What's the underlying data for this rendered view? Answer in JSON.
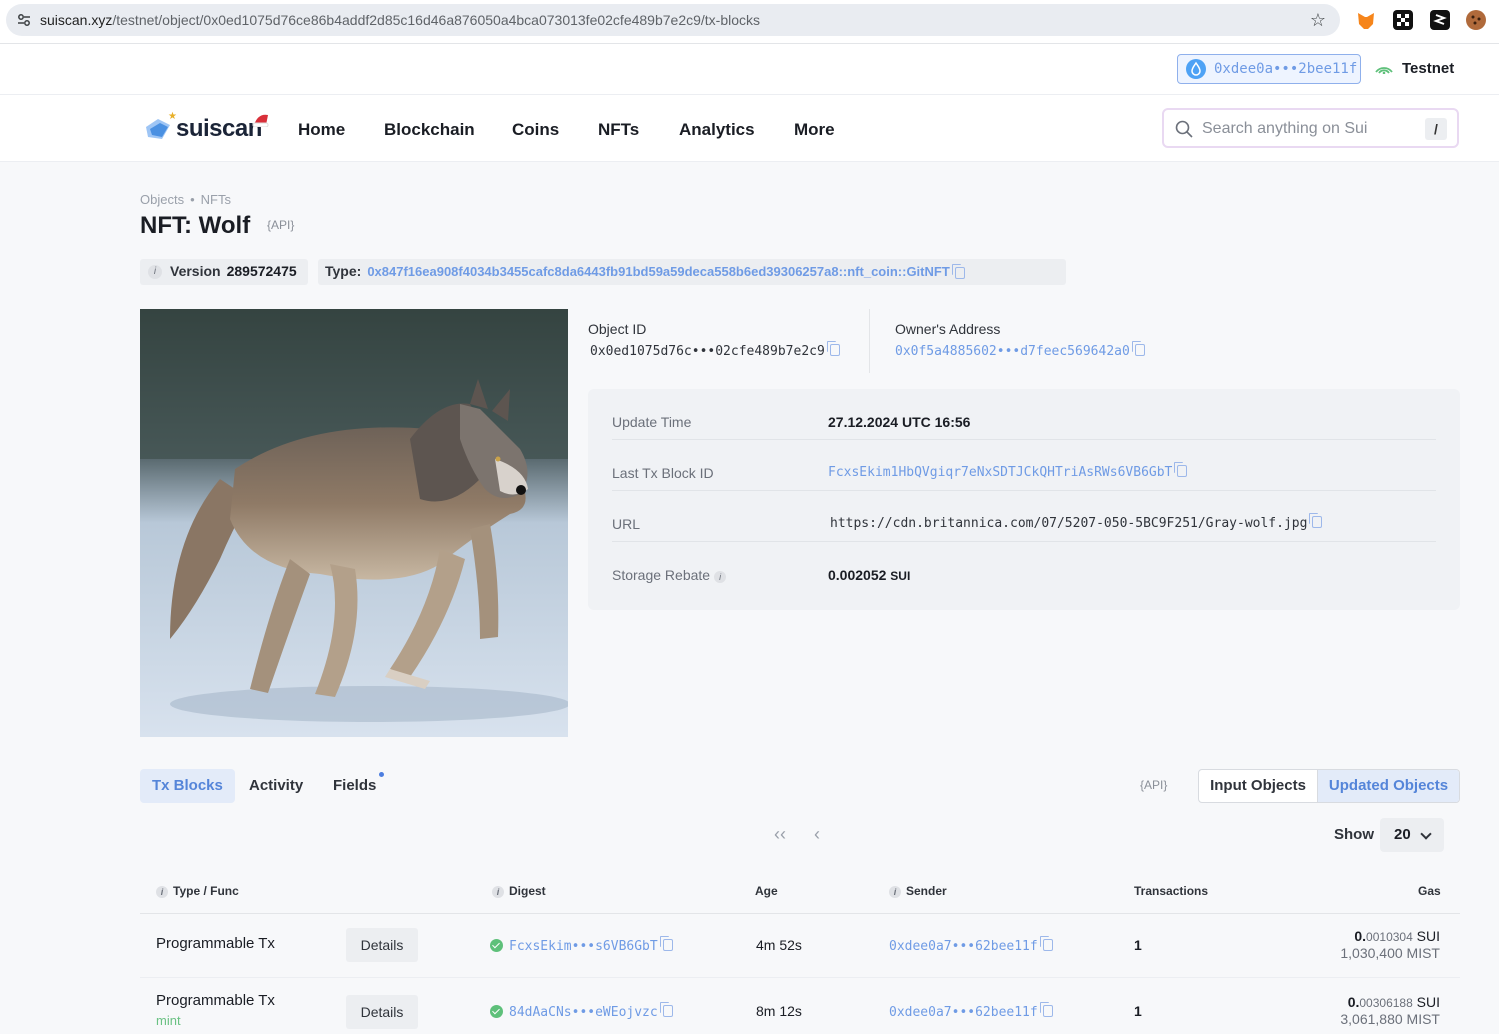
{
  "browser": {
    "url_host": "suiscan.xyz",
    "url_path": "/testnet/object/0x0ed1075d76ce86b4addf2d85c16d46a876050a4bca073013fe02cfe489b7e2c9/tx-blocks"
  },
  "topbar": {
    "wallet_address": "0xdee0a•••2bee11f",
    "network": "Testnet"
  },
  "nav": {
    "logo": "suiscan",
    "items": [
      "Home",
      "Blockchain",
      "Coins",
      "NFTs",
      "Analytics",
      "More"
    ],
    "search_placeholder": "Search anything on Sui",
    "search_shortcut": "/"
  },
  "breadcrumb": [
    "Objects",
    "NFTs"
  ],
  "page": {
    "title": "NFT: Wolf",
    "api_badge": "{API}",
    "version_label": "Version",
    "version_value": "289572475",
    "type_label": "Type:",
    "type_value": "0x847f16ea908f4034b3455cafc8da6443fb91bd59a59deca558b6ed39306257a8::nft_coin::GitNFT"
  },
  "object": {
    "object_id_label": "Object ID",
    "object_id": "0x0ed1075d76c•••02cfe489b7e2c9",
    "owner_label": "Owner's Address",
    "owner": "0x0f5a4885602•••d7feec569642a0"
  },
  "details": [
    {
      "key": "Update Time",
      "value": "27.12.2024 UTC 16:56"
    },
    {
      "key": "Last Tx Block ID",
      "value": "FcxsEkim1HbQVgiqr7eNxSDTJCkQHTriAsRWs6VB6GbT"
    },
    {
      "key": "URL",
      "value": "https://cdn.britannica.com/07/5207-050-5BC9F251/Gray-wolf.jpg"
    },
    {
      "key": "Storage Rebate",
      "value": "0.002052",
      "unit": "SUI"
    }
  ],
  "tabs": {
    "items": [
      "Tx Blocks",
      "Activity",
      "Fields"
    ],
    "api_badge": "{API}",
    "segment": [
      "Input Objects",
      "Updated Objects"
    ]
  },
  "pager": {
    "first": "‹‹",
    "prev": "‹",
    "show_label": "Show",
    "show_value": "20"
  },
  "table": {
    "headers": [
      "Type / Func",
      "Digest",
      "Age",
      "Sender",
      "Transactions",
      "Gas"
    ],
    "rows": [
      {
        "type": "Programmable Tx",
        "func": "",
        "details": "Details",
        "digest": "FcxsEkim•••s6VB6GbT",
        "age": "4m 52s",
        "sender": "0xdee0a7•••62bee11f",
        "transactions": "1",
        "gas_int": "0.",
        "gas_frac": "0010304",
        "gas_unit": "SUI",
        "gas_mist": "1,030,400 MIST"
      },
      {
        "type": "Programmable Tx",
        "func": "mint",
        "details": "Details",
        "digest": "84dAaCNs•••eWEojvzc",
        "age": "8m 12s",
        "sender": "0xdee0a7•••62bee11f",
        "transactions": "1",
        "gas_int": "0.",
        "gas_frac": "00306188",
        "gas_unit": "SUI",
        "gas_mist": "3,061,880 MIST"
      }
    ]
  },
  "colors": {
    "accent": "#5585d9",
    "link": "#6f9be5",
    "success": "#5ec07a",
    "background": "#f7f8fa"
  }
}
